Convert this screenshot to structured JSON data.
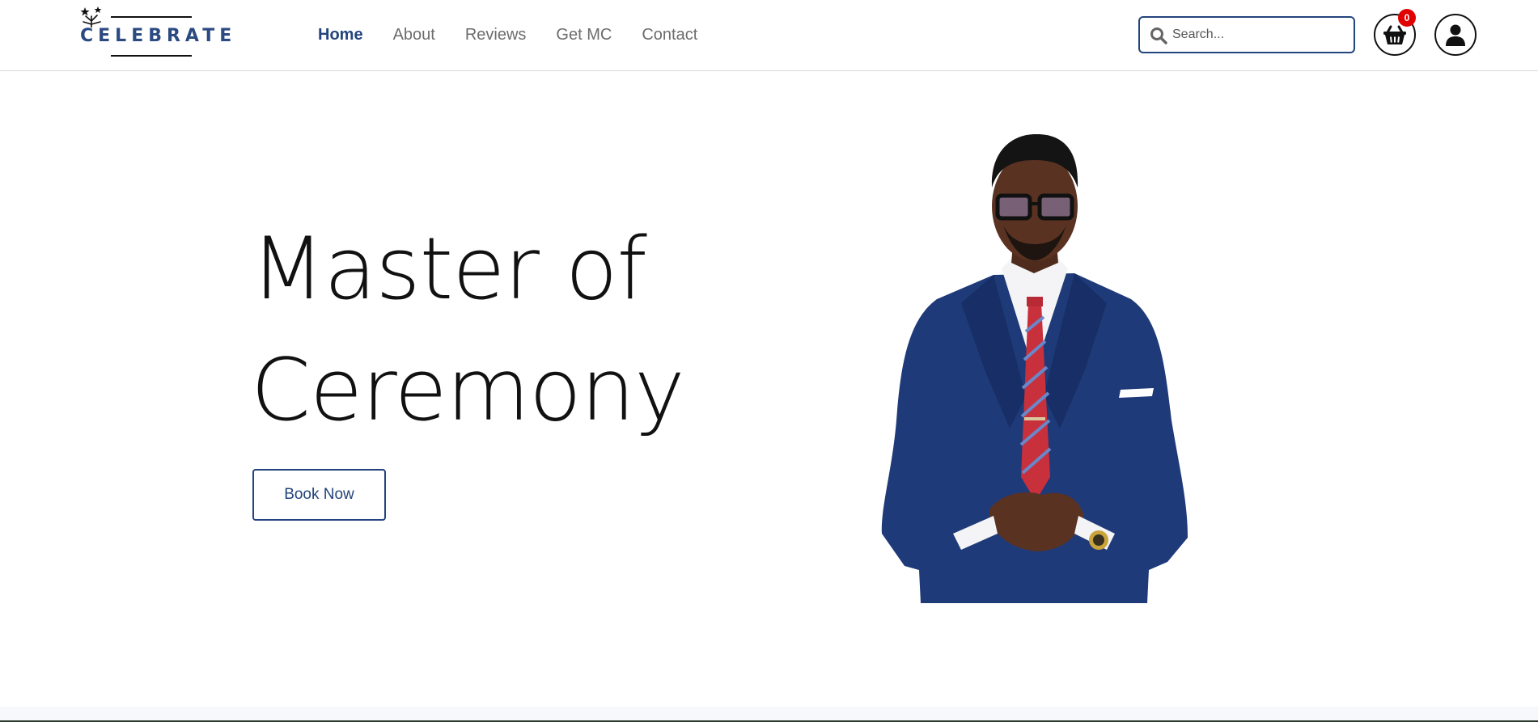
{
  "header": {
    "logo_text": "CELEBRATE",
    "nav": [
      {
        "label": "Home",
        "active": true
      },
      {
        "label": "About",
        "active": false
      },
      {
        "label": "Reviews",
        "active": false
      },
      {
        "label": "Get MC",
        "active": false
      },
      {
        "label": "Contact",
        "active": false
      }
    ],
    "search": {
      "placeholder": "Search...",
      "value": "",
      "icon": "search-icon"
    },
    "cart": {
      "icon": "basket-icon",
      "count": "0"
    },
    "user": {
      "icon": "user-icon"
    }
  },
  "hero": {
    "title_line1": "Master of",
    "title_line2": "Ceremony",
    "cta_label": "Book Now",
    "image": "portrait-of-man-in-navy-suit"
  },
  "colors": {
    "brand": "#23447c",
    "text": "#111111",
    "nav_muted": "#6c6c6c",
    "badge": "#e00000"
  }
}
